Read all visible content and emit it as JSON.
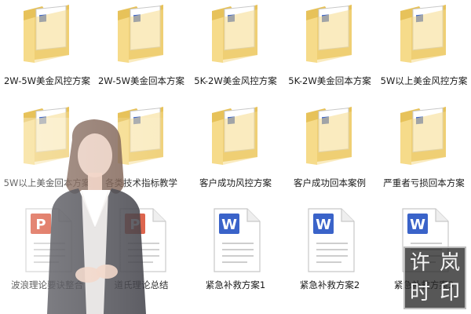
{
  "files": [
    {
      "name": "2W-5W美金风控方案",
      "type": "folder"
    },
    {
      "name": "2W-5W美金回本方案",
      "type": "folder"
    },
    {
      "name": "5K-2W美金风控方案",
      "type": "folder"
    },
    {
      "name": "5K-2W美金回本方案",
      "type": "folder"
    },
    {
      "name": "5W以上美金风控方案",
      "type": "folder"
    },
    {
      "name": "5W以上美金回本方案",
      "type": "folder"
    },
    {
      "name": "各类技术指标教学",
      "type": "folder"
    },
    {
      "name": "客户成功风控方案",
      "type": "folder"
    },
    {
      "name": "客户成功回本案例",
      "type": "folder"
    },
    {
      "name": "严重者亏损回本方案",
      "type": "folder"
    },
    {
      "name": "波浪理论要诀整合",
      "type": "ppt"
    },
    {
      "name": "道氏理论总结",
      "type": "ppt"
    },
    {
      "name": "紧急补救方案1",
      "type": "word"
    },
    {
      "name": "紧急补救方案2",
      "type": "word"
    },
    {
      "name": "紧急补救方案3",
      "type": "word"
    }
  ],
  "watermark": {
    "seal_chars": [
      "许",
      "岚",
      "时",
      "印"
    ]
  },
  "colors": {
    "folder_back": "#e7c25a",
    "folder_front": "#f6db8a",
    "word_blue": "#3a63c9",
    "ppt_red": "#d9543a"
  }
}
